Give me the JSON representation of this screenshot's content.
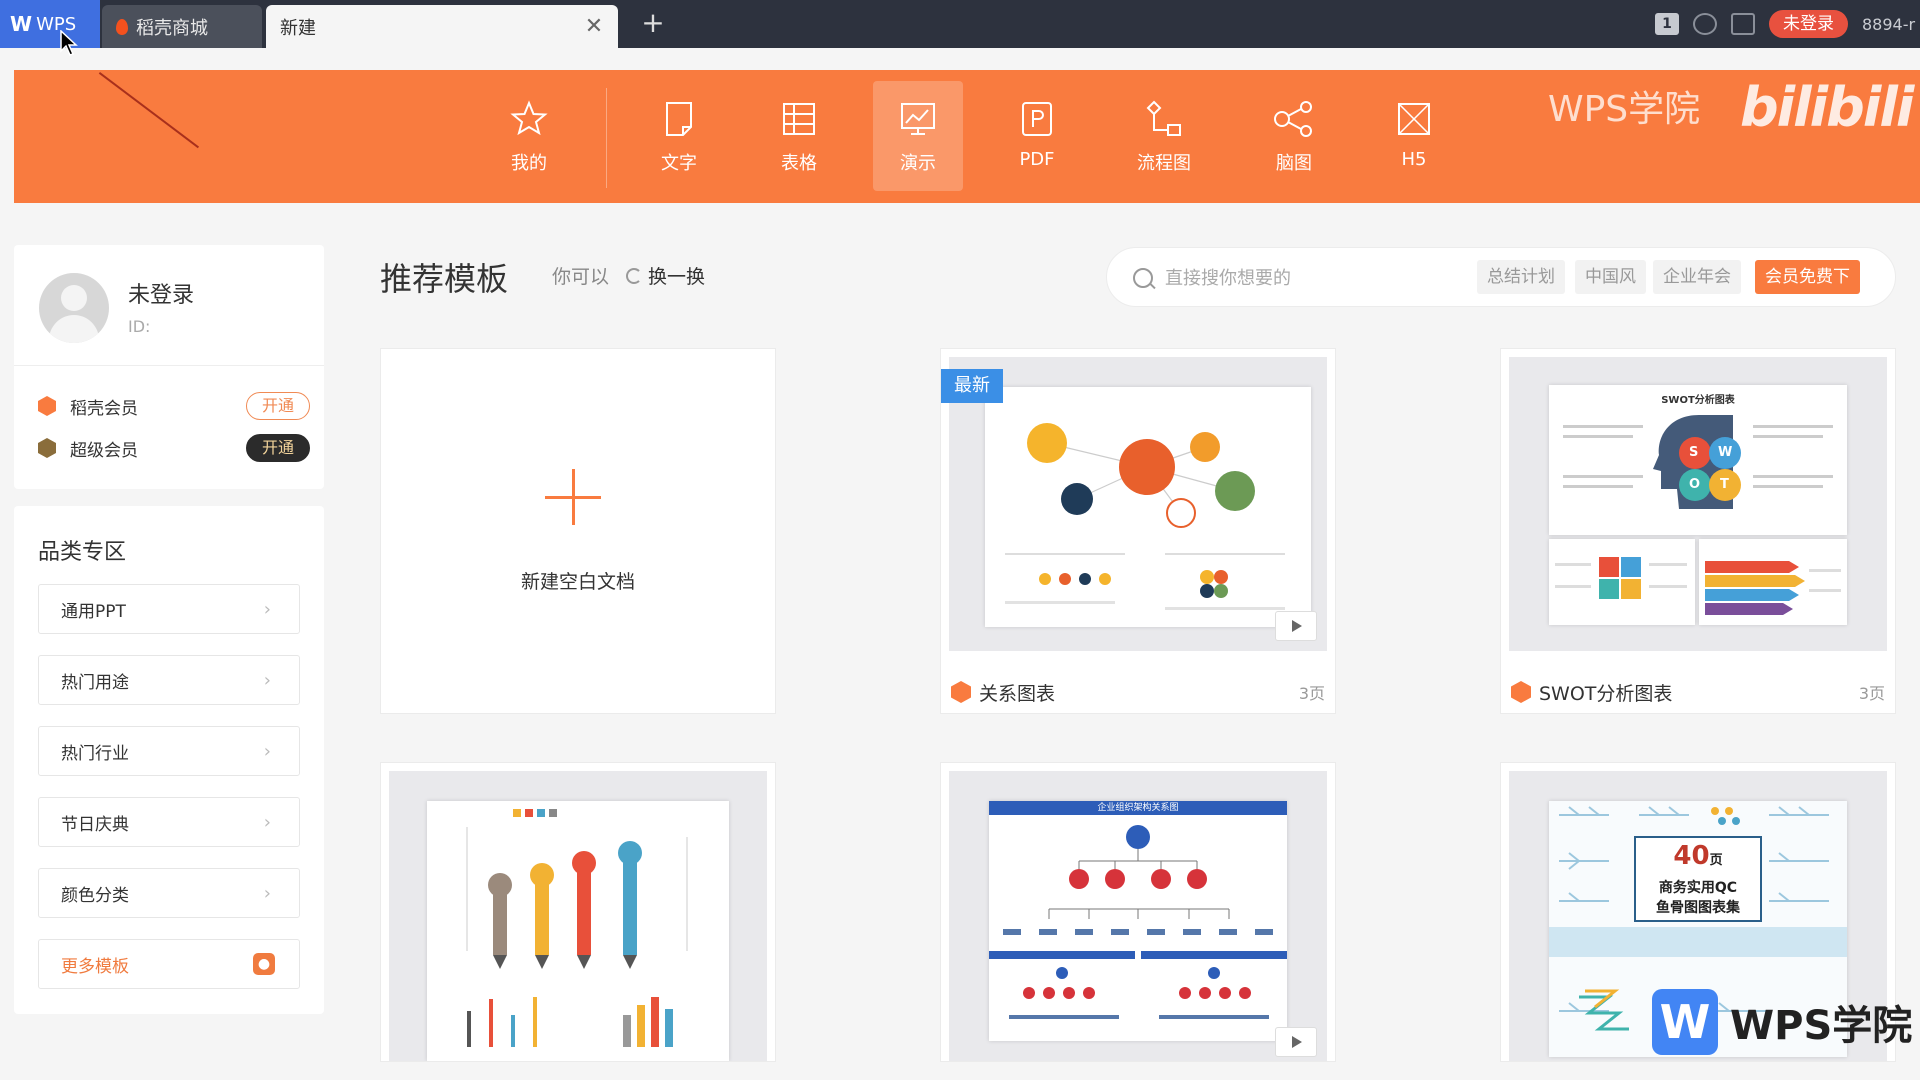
{
  "titlebar": {
    "tabs": [
      {
        "label": "WPS"
      },
      {
        "label": "稻壳商城"
      },
      {
        "label": "新建"
      }
    ],
    "close_glyph": "✕",
    "add_glyph": "+",
    "badge_num": "1",
    "login_label": "未登录",
    "user_code": "8894-r"
  },
  "nav": {
    "items": [
      {
        "label": "我的",
        "icon": "star-icon"
      },
      {
        "label": "文字",
        "icon": "document-icon"
      },
      {
        "label": "表格",
        "icon": "table-icon"
      },
      {
        "label": "演示",
        "icon": "presentation-icon",
        "active": true
      },
      {
        "label": "PDF",
        "icon": "pdf-icon"
      },
      {
        "label": "流程图",
        "icon": "flowchart-icon"
      },
      {
        "label": "脑图",
        "icon": "mindmap-icon"
      },
      {
        "label": "H5",
        "icon": "h5-icon"
      }
    ],
    "watermark": "WPS学院",
    "watermark2": "bilibili"
  },
  "profile": {
    "name": "未登录",
    "id_label": "ID:",
    "vip": [
      {
        "label": "稻壳会员",
        "button": "开通",
        "color": "#f97b3f"
      },
      {
        "label": "超级会员",
        "button": "开通",
        "color": "#8a6d3b"
      }
    ]
  },
  "category": {
    "title": "品类专区",
    "items": [
      "通用PPT",
      "热门用途",
      "热门行业",
      "节日庆典",
      "颜色分类"
    ],
    "more": "更多模板",
    "chevron": "›"
  },
  "main": {
    "title": "推荐模板",
    "hint": "你可以",
    "refresh": "换一换",
    "search": {
      "placeholder": "直接搜你想要的",
      "tags": [
        "总结计划",
        "中国风",
        "企业年会",
        "会员免费下"
      ]
    }
  },
  "cards": {
    "blank_label": "新建空白文档",
    "newest_badge": "最新",
    "items": [
      {
        "title": "关系图表",
        "pages": "3页"
      },
      {
        "title": "SWOT分析图表",
        "pages": "3页"
      }
    ],
    "org_title": "企业组织架构关系图",
    "fishbone_num": "40",
    "fishbone_unit": "页",
    "fishbone_line1": "商务实用QC",
    "fishbone_line2": "鱼骨图图表集",
    "swot_heading": "SWOT分析图表",
    "swot_letters": [
      "S",
      "W",
      "O",
      "T"
    ]
  },
  "academy": {
    "mark": "W",
    "text": "WPS学院"
  },
  "colors": {
    "accent": "#f97b3f",
    "titlebar": "#2d323e",
    "wps_blue": "#3f6fe0"
  }
}
